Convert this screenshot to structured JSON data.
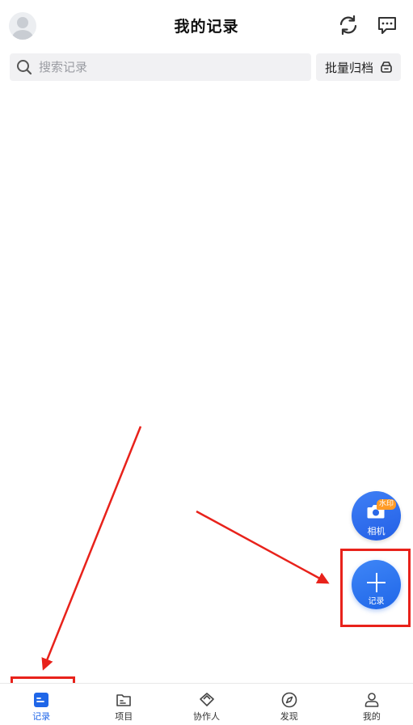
{
  "header": {
    "title": "我的记录",
    "avatar_icon": "user-avatar-icon",
    "sync_icon": "sync-icon",
    "message_icon": "message-icon"
  },
  "search": {
    "placeholder": "搜索记录",
    "icon": "search-icon"
  },
  "batch_archive": {
    "label": "批量归档",
    "icon": "archive-icon"
  },
  "fab": {
    "camera": {
      "label": "相机",
      "badge": "水印",
      "icon": "camera-icon"
    },
    "record": {
      "label": "记录",
      "icon": "plus-icon"
    }
  },
  "tabbar": {
    "active_color": "#1f66e8",
    "items": [
      {
        "label": "记录",
        "icon": "record-icon",
        "active": true
      },
      {
        "label": "项目",
        "icon": "folder-icon",
        "active": false
      },
      {
        "label": "协作人",
        "icon": "collaborator-icon",
        "active": false
      },
      {
        "label": "发现",
        "icon": "compass-icon",
        "active": false
      },
      {
        "label": "我的",
        "icon": "profile-icon",
        "active": false
      }
    ]
  },
  "annotation": {
    "highlight_color": "#e8221b"
  }
}
